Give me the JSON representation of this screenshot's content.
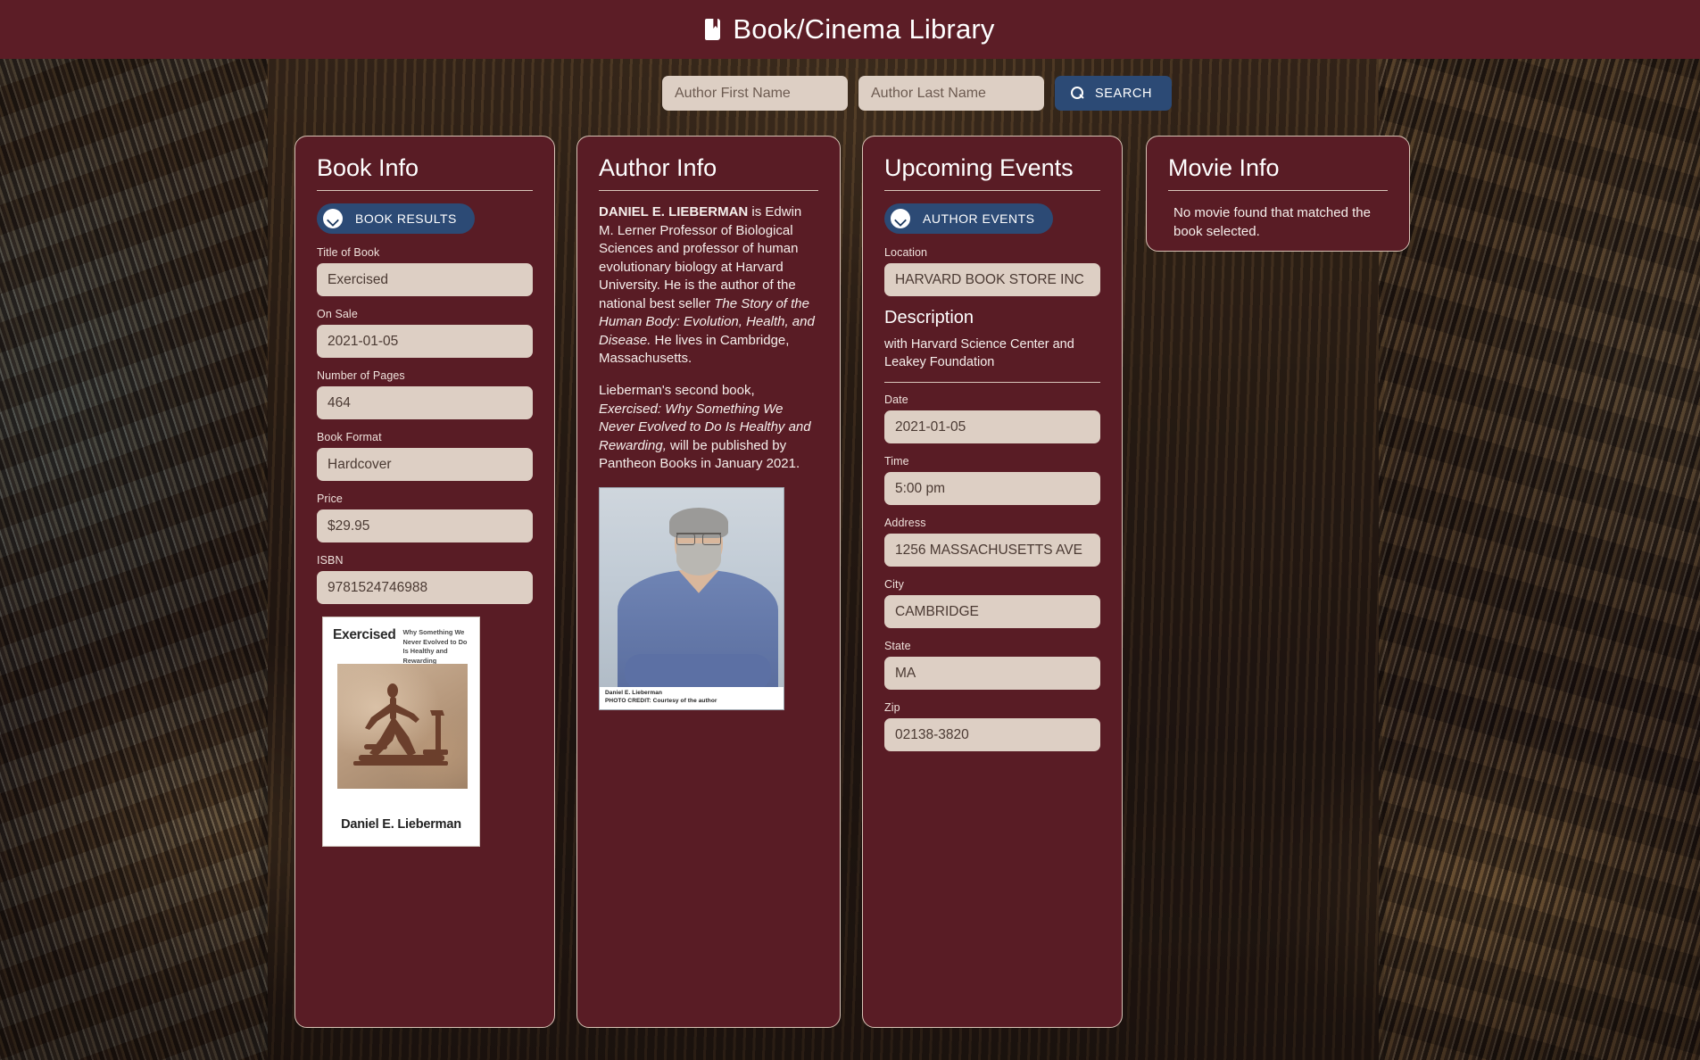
{
  "header": {
    "title": "Book/Cinema Library",
    "icon": "book-icon"
  },
  "search": {
    "first_name_placeholder": "Author First Name",
    "first_name_value": "",
    "last_name_placeholder": "Author Last Name",
    "last_name_value": "",
    "button_label": "SEARCH",
    "button_icon": "search-icon"
  },
  "book_info": {
    "title": "Book Info",
    "results_button_label": "BOOK RESULTS",
    "results_button_icon": "chevron-down-icon",
    "fields": [
      {
        "label": "Title of Book",
        "value": "Exercised"
      },
      {
        "label": "On Sale",
        "value": "2021-01-05"
      },
      {
        "label": "Number of Pages",
        "value": "464"
      },
      {
        "label": "Book Format",
        "value": "Hardcover"
      },
      {
        "label": "Price",
        "value": "$29.95"
      },
      {
        "label": "ISBN",
        "value": "9781524746988"
      }
    ],
    "cover": {
      "title": "Exercised",
      "subtitle": "Why Something We Never Evolved to Do Is Healthy and Rewarding",
      "author": "Daniel E. Lieberman"
    }
  },
  "author_info": {
    "title": "Author Info",
    "bio_name": "DANIEL E. LIEBERMAN",
    "bio_p1_a": " is Edwin M. Lerner Professor of Biological Sciences and professor of human evolutionary biology at Harvard University. He is the author of the national best seller ",
    "bio_p1_em": "The Story of the Human Body: Evolution, Health, and Disease.",
    "bio_p1_b": " He lives in Cambridge, Massachusetts.",
    "bio_p2_a": "Lieberman's second book, ",
    "bio_p2_em": "Exercised: Why Something We Never Evolved to Do Is Healthy and Rewarding,",
    "bio_p2_b": " will be published by Pantheon Books in January 2021.",
    "photo_caption_line1": "Daniel E. Lieberman",
    "photo_caption_line2": "PHOTO CREDIT: Courtesy of the author"
  },
  "events": {
    "title": "Upcoming Events",
    "results_button_label": "AUTHOR EVENTS",
    "results_button_icon": "chevron-down-icon",
    "location_label": "Location",
    "location_value": "HARVARD BOOK STORE INC",
    "description_heading": "Description",
    "description_text": "with Harvard Science Center and Leakey Foundation",
    "fields": [
      {
        "label": "Date",
        "value": "2021-01-05"
      },
      {
        "label": "Time",
        "value": "5:00 pm"
      },
      {
        "label": "Address",
        "value": "1256 MASSACHUSETTS AVE"
      },
      {
        "label": "City",
        "value": "CAMBRIDGE"
      },
      {
        "label": "State",
        "value": "MA"
      },
      {
        "label": "Zip",
        "value": "02138-3820"
      }
    ]
  },
  "movie_info": {
    "title": "Movie Info",
    "message": "No movie found that matched the book selected."
  },
  "colors": {
    "header_bg": "#5c1d26",
    "card_bg": "#591c25",
    "card_border": "#d8c3b6",
    "button_blue": "#2c4a75",
    "input_bg": "#ddcfc4"
  }
}
